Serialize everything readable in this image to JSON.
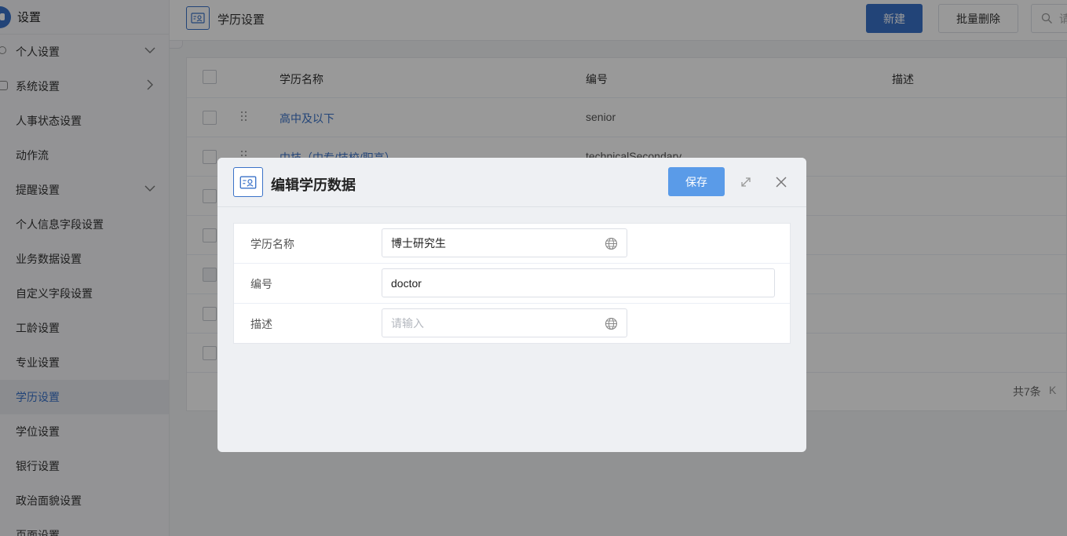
{
  "sidebar": {
    "title": "设置",
    "items": [
      {
        "label": "个人设置",
        "chevron": "down"
      },
      {
        "label": "系统设置",
        "chevron": "right"
      },
      {
        "label": "人事状态设置"
      },
      {
        "label": "动作流"
      },
      {
        "label": "提醒设置",
        "chevron": "down"
      },
      {
        "label": "个人信息字段设置"
      },
      {
        "label": "业务数据设置"
      },
      {
        "label": "自定义字段设置"
      },
      {
        "label": "工龄设置"
      },
      {
        "label": "专业设置"
      },
      {
        "label": "学历设置",
        "active": true
      },
      {
        "label": "学位设置"
      },
      {
        "label": "银行设置"
      },
      {
        "label": "政治面貌设置"
      },
      {
        "label": "页面设置"
      }
    ]
  },
  "header": {
    "title": "学历设置",
    "new_label": "新建",
    "batch_delete_label": "批量删除",
    "search_placeholder": "请"
  },
  "table": {
    "columns": [
      "学历名称",
      "编号",
      "描述"
    ],
    "rows": [
      {
        "name": "高中及以下",
        "code": "senior",
        "desc": ""
      },
      {
        "name": "中技（中专/技校/职高）",
        "code": "technicalSecondary",
        "desc": ""
      },
      {
        "name": "",
        "code": "",
        "desc": ""
      },
      {
        "name": "",
        "code": "",
        "desc": ""
      },
      {
        "name": "",
        "code": "",
        "desc": ""
      },
      {
        "name": "",
        "code": "",
        "desc": ""
      },
      {
        "name": "",
        "code": "",
        "desc": ""
      }
    ],
    "total_label": "共7条",
    "prev_label": "K"
  },
  "modal": {
    "title": "编辑学历数据",
    "save_label": "保存",
    "fields": [
      {
        "label": "学历名称",
        "value": "博士研究生",
        "placeholder": ""
      },
      {
        "label": "编号",
        "value": "doctor",
        "placeholder": ""
      },
      {
        "label": "描述",
        "value": "",
        "placeholder": "请输入"
      }
    ]
  },
  "colors": {
    "accent": "#3a72c8",
    "save_button": "#5a9be8",
    "overlay": "rgba(0,0,0,0.4)"
  }
}
